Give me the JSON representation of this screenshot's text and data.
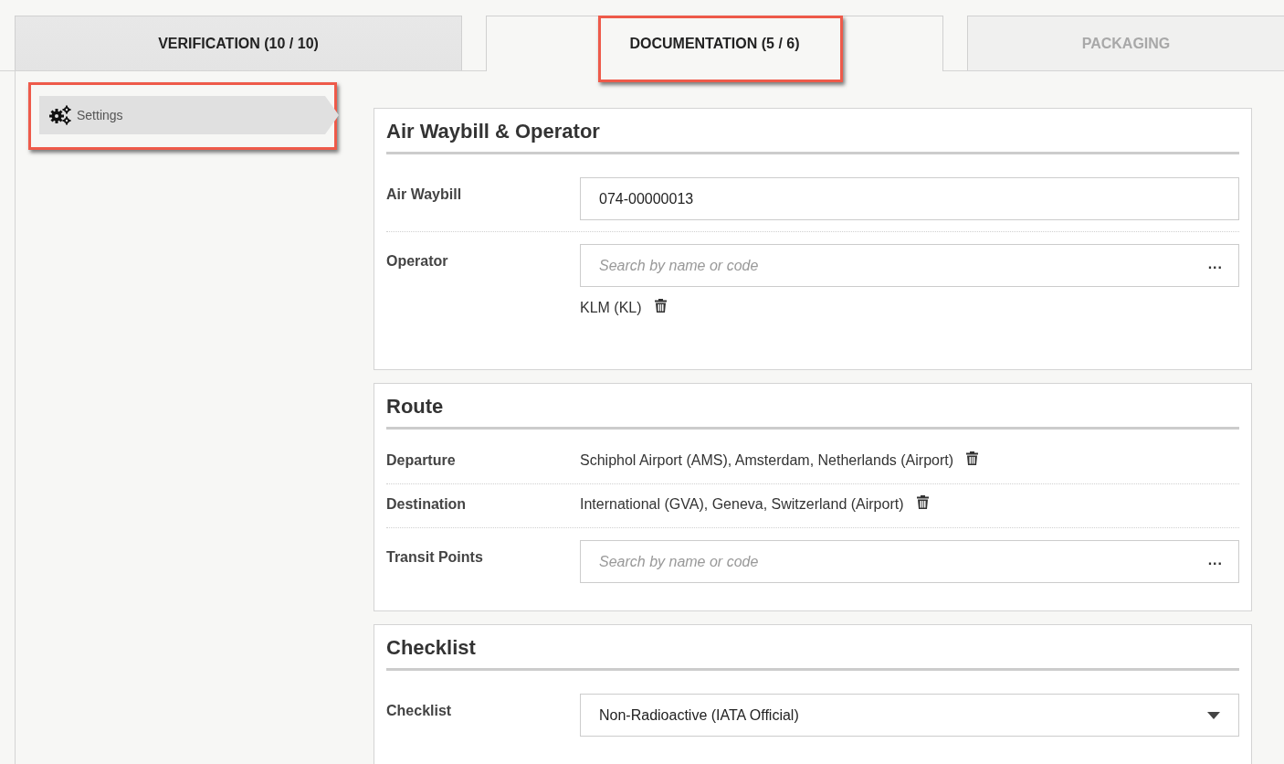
{
  "tabs": [
    {
      "label": "VERIFICATION (10 / 10)",
      "selected": false,
      "disabled": false,
      "highlighted": false
    },
    {
      "label": "DOCUMENTATION (5 / 6)",
      "selected": true,
      "disabled": false,
      "highlighted": true
    },
    {
      "label": "PACKAGING",
      "selected": false,
      "disabled": true,
      "highlighted": false
    }
  ],
  "sidebar": {
    "items": [
      {
        "label": "Settings",
        "selected": true,
        "highlighted": true
      }
    ]
  },
  "sections": [
    {
      "title": "Air Waybill & Operator",
      "rows": [
        {
          "kind": "input",
          "label": "Air Waybill",
          "value": "074-00000013"
        },
        {
          "kind": "search",
          "label": "Operator",
          "placeholder": "Search by name or code",
          "more": "...",
          "chips": [
            "KLM (KL)"
          ]
        }
      ]
    },
    {
      "title": "Route",
      "rows": [
        {
          "kind": "value",
          "label": "Departure",
          "value": "Schiphol Airport (AMS), Amsterdam, Netherlands (Airport)"
        },
        {
          "kind": "value",
          "label": "Destination",
          "value": "International (GVA), Geneva, Switzerland (Airport)"
        },
        {
          "kind": "search",
          "label": "Transit Points",
          "placeholder": "Search by name or code",
          "more": "..."
        }
      ]
    },
    {
      "title": "Checklist",
      "rows": [
        {
          "kind": "select",
          "label": "Checklist",
          "value": "Non-Radioactive (IATA Official)"
        }
      ]
    }
  ]
}
